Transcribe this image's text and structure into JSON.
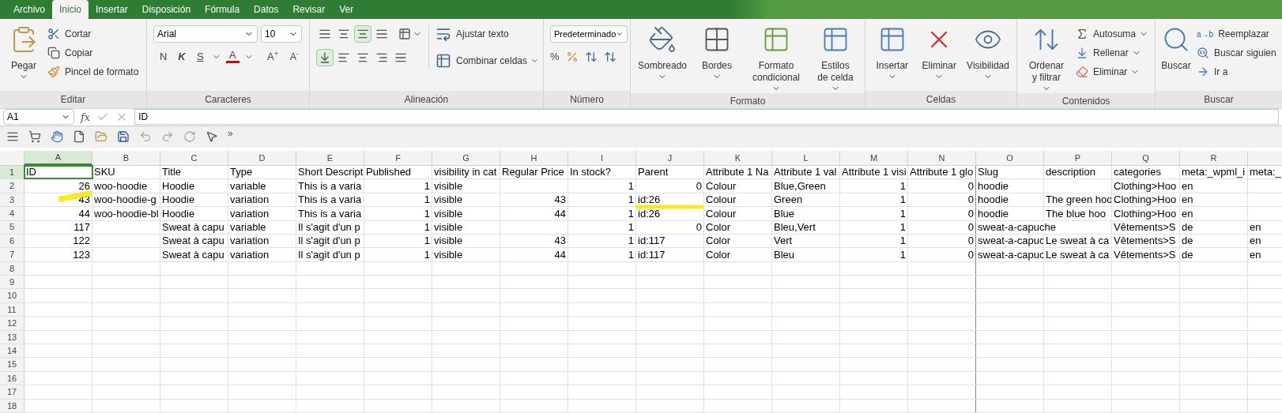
{
  "menu_tabs": [
    {
      "label": "Archivo",
      "selected": false
    },
    {
      "label": "Inicio",
      "selected": true
    },
    {
      "label": "Insertar",
      "selected": false
    },
    {
      "label": "Disposición",
      "selected": false
    },
    {
      "label": "Fórmula",
      "selected": false
    },
    {
      "label": "Datos",
      "selected": false
    },
    {
      "label": "Revisar",
      "selected": false
    },
    {
      "label": "Ver",
      "selected": false
    }
  ],
  "clipboard": {
    "paste": "Pegar",
    "cut": "Cortar",
    "copy": "Copiar",
    "format_painter": "Pincel de formato",
    "label": "Editar"
  },
  "font": {
    "family": "Arial",
    "size": "10",
    "bold": "N",
    "italic": "K",
    "underline": "S",
    "color_letter": "A",
    "grow": "A",
    "grow_mark": "+",
    "shrink": "A",
    "shrink_mark": "-",
    "label": "Caracteres"
  },
  "alignment": {
    "top_row": [
      {
        "selected": false
      },
      {
        "selected": false
      },
      {
        "selected": true
      },
      {
        "selected": false
      }
    ],
    "bottom_row": [
      {
        "selected": true
      },
      {
        "selected": false
      },
      {
        "selected": false
      },
      {
        "selected": false
      },
      {
        "selected": false
      }
    ],
    "wrap": "Ajustar texto",
    "merge": "Combinar celdas",
    "label": "Alineación"
  },
  "number": {
    "format": "Predeterminado",
    "percent": "%",
    "label": "Número"
  },
  "format": {
    "buttons": [
      "Sombreado",
      "Bordes",
      "Formato condicional",
      "Estilos de celda"
    ],
    "label": "Formato"
  },
  "cells": {
    "buttons": [
      "Insertar",
      "Eliminar",
      "Visibilidad"
    ],
    "label": "Celdas"
  },
  "contents": {
    "sort": "Ordenar y filtrar",
    "autosum": "Autosuma",
    "fill": "Rellenar",
    "clear": "Eliminar",
    "label": "Contenidos"
  },
  "find": {
    "find": "Buscar",
    "replace_icon": "a→b",
    "replace": "Reemplazar",
    "find_next": "Buscar siguien",
    "goto": "Ir a",
    "label": "Buscar"
  },
  "formula_bar": {
    "cell_ref": "A1",
    "function_label": "fx",
    "value": "ID"
  },
  "quick_toolbar": {
    "more": "»"
  },
  "sheet": {
    "columns": [
      {
        "label": "A",
        "selected": true
      },
      {
        "label": "B",
        "selected": false
      },
      {
        "label": "C",
        "selected": false
      },
      {
        "label": "D",
        "selected": false
      },
      {
        "label": "E",
        "selected": false
      },
      {
        "label": "F",
        "selected": false
      },
      {
        "label": "G",
        "selected": false
      },
      {
        "label": "H",
        "selected": false
      },
      {
        "label": "I",
        "selected": false
      },
      {
        "label": "J",
        "selected": false
      },
      {
        "label": "K",
        "selected": false
      },
      {
        "label": "L",
        "selected": false
      },
      {
        "label": "M",
        "selected": false
      },
      {
        "label": "N",
        "selected": false
      },
      {
        "label": "O",
        "selected": false
      },
      {
        "label": "P",
        "selected": false
      },
      {
        "label": "Q",
        "selected": false
      },
      {
        "label": "R",
        "selected": false
      }
    ],
    "row_headers": [
      {
        "label": "1",
        "selected": true
      },
      {
        "label": "2",
        "selected": false
      },
      {
        "label": "3",
        "selected": false
      },
      {
        "label": "4",
        "selected": false
      },
      {
        "label": "5",
        "selected": false
      },
      {
        "label": "6",
        "selected": false
      },
      {
        "label": "7",
        "selected": false
      },
      {
        "label": "8",
        "selected": false
      },
      {
        "label": "9",
        "selected": false
      },
      {
        "label": "10",
        "selected": false
      },
      {
        "label": "11",
        "selected": false
      },
      {
        "label": "12",
        "selected": false
      },
      {
        "label": "13",
        "selected": false
      },
      {
        "label": "14",
        "selected": false
      },
      {
        "label": "15",
        "selected": false
      },
      {
        "label": "16",
        "selected": false
      },
      {
        "label": "17",
        "selected": false
      },
      {
        "label": "18",
        "selected": false
      }
    ],
    "rows": [
      [
        "ID",
        "SKU",
        "Title",
        "Type",
        "Short Descript",
        "Published",
        "visibility in cat",
        "Regular Price",
        "In stock?",
        "Parent",
        "Attribute 1 Na",
        "Attribute 1 val",
        "Attribute 1 visi",
        "Attribute 1 glo",
        "Slug",
        "description",
        "categories",
        "meta:_wpml_i",
        "meta:_"
      ],
      [
        {
          "number": "26"
        },
        "woo-hoodie",
        "Hoodie",
        "variable",
        "This is a varia",
        {
          "number": "1"
        },
        "visible",
        "",
        {
          "number": "1"
        },
        {
          "number": "0"
        },
        "Colour",
        "Blue,Green",
        {
          "number": "1"
        },
        {
          "number": "0"
        },
        "hoodie",
        "",
        "Clothing>Hoo",
        "en",
        ""
      ],
      [
        {
          "number": "43"
        },
        "woo-hoodie-g",
        "Hoodie",
        "variation",
        "This is a varia",
        {
          "number": "1"
        },
        "visible",
        {
          "number": "43"
        },
        {
          "number": "1"
        },
        "id:26",
        "Colour",
        "Green",
        {
          "number": "1"
        },
        {
          "number": "0"
        },
        "hoodie",
        "The green hoo",
        "Clothing>Hoo",
        "en",
        ""
      ],
      [
        {
          "number": "44"
        },
        "woo-hoodie-bl",
        "Hoodie",
        "variation",
        "This is a varia",
        {
          "number": "1"
        },
        "visible",
        {
          "number": "44"
        },
        {
          "number": "1"
        },
        "id:26",
        "Colour",
        "Blue",
        {
          "number": "1"
        },
        {
          "number": "0"
        },
        "hoodie",
        "The blue hoo",
        "Clothing>Hoo",
        "en",
        ""
      ],
      [
        {
          "number": "117"
        },
        "",
        "Sweat à capu",
        "variable",
        "Il s'agit d'un p",
        {
          "number": "1"
        },
        "visible",
        "",
        {
          "number": "1"
        },
        {
          "number": "0"
        },
        "Color",
        "Bleu,Vert",
        {
          "number": "1"
        },
        {
          "number": "0"
        },
        "sweat-a-capuche",
        "",
        "Vêtements>S",
        "de",
        "en"
      ],
      [
        {
          "number": "122"
        },
        "",
        "Sweat à capu",
        "variation",
        "Il s'agit d'un p",
        {
          "number": "1"
        },
        "visible",
        {
          "number": "43"
        },
        {
          "number": "1"
        },
        "id:117",
        "Color",
        "Vert",
        {
          "number": "1"
        },
        {
          "number": "0"
        },
        "sweat-a-capuc",
        "Le sweat à ca",
        "Vêtements>S",
        "de",
        "en"
      ],
      [
        {
          "number": "123"
        },
        "",
        "Sweat à capu",
        "variation",
        "Il s'agit d'un p",
        {
          "number": "1"
        },
        "visible",
        {
          "number": "44"
        },
        {
          "number": "1"
        },
        "id:117",
        "Color",
        "Bleu",
        {
          "number": "1"
        },
        {
          "number": "0"
        },
        "sweat-a-capuc",
        "Le sweat à ca",
        "Vêtements>S",
        "de",
        "en"
      ]
    ]
  }
}
